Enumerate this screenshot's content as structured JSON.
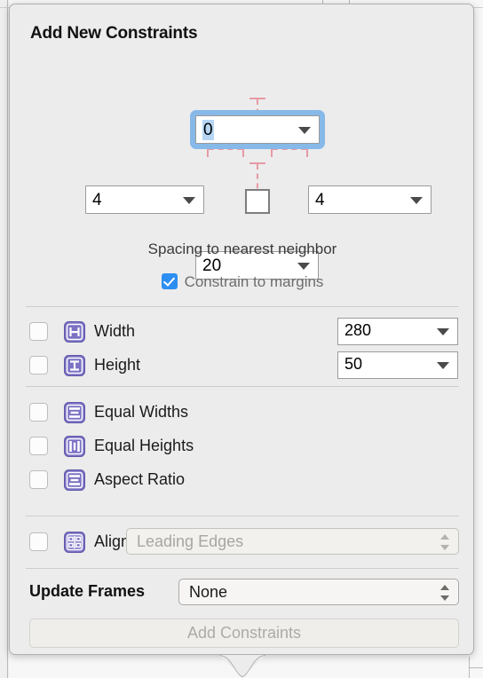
{
  "popover": {
    "title": "Add New Constraints"
  },
  "spacing": {
    "top": {
      "value": "0",
      "name": "top-spacing"
    },
    "left": {
      "value": "4",
      "name": "leading-spacing"
    },
    "right": {
      "value": "4",
      "name": "trailing-spacing"
    },
    "bottom": {
      "value": "20",
      "name": "bottom-spacing"
    },
    "caption": "Spacing to nearest neighbor",
    "margins_label": "Constrain to margins",
    "margins_checked": true
  },
  "size": {
    "width": {
      "label": "Width",
      "value": "280",
      "icon": "width-icon",
      "checked": false
    },
    "height": {
      "label": "Height",
      "value": "50",
      "icon": "height-icon",
      "checked": false
    }
  },
  "relations": {
    "equal_widths": {
      "label": "Equal Widths",
      "icon": "equal-widths-icon",
      "checked": false
    },
    "equal_heights": {
      "label": "Equal Heights",
      "icon": "equal-heights-icon",
      "checked": false
    },
    "aspect_ratio": {
      "label": "Aspect Ratio",
      "icon": "aspect-ratio-icon",
      "checked": false
    }
  },
  "align": {
    "label": "Align",
    "icon": "align-icon",
    "checked": false,
    "selected": "Leading Edges",
    "enabled": false
  },
  "update_frames": {
    "label": "Update Frames",
    "selected": "None",
    "enabled": true
  },
  "action": {
    "add_label": "Add Constraints",
    "enabled": false
  },
  "colors": {
    "panel_bg": "#ececec",
    "focus_ring": "#86b9e8",
    "selection": "#b6d6f4",
    "connector": "#e79aa4",
    "icon_purple": "#7b72c4",
    "checkbox_blue": "#2d8ef2",
    "disabled_text": "#a8a6a2"
  }
}
